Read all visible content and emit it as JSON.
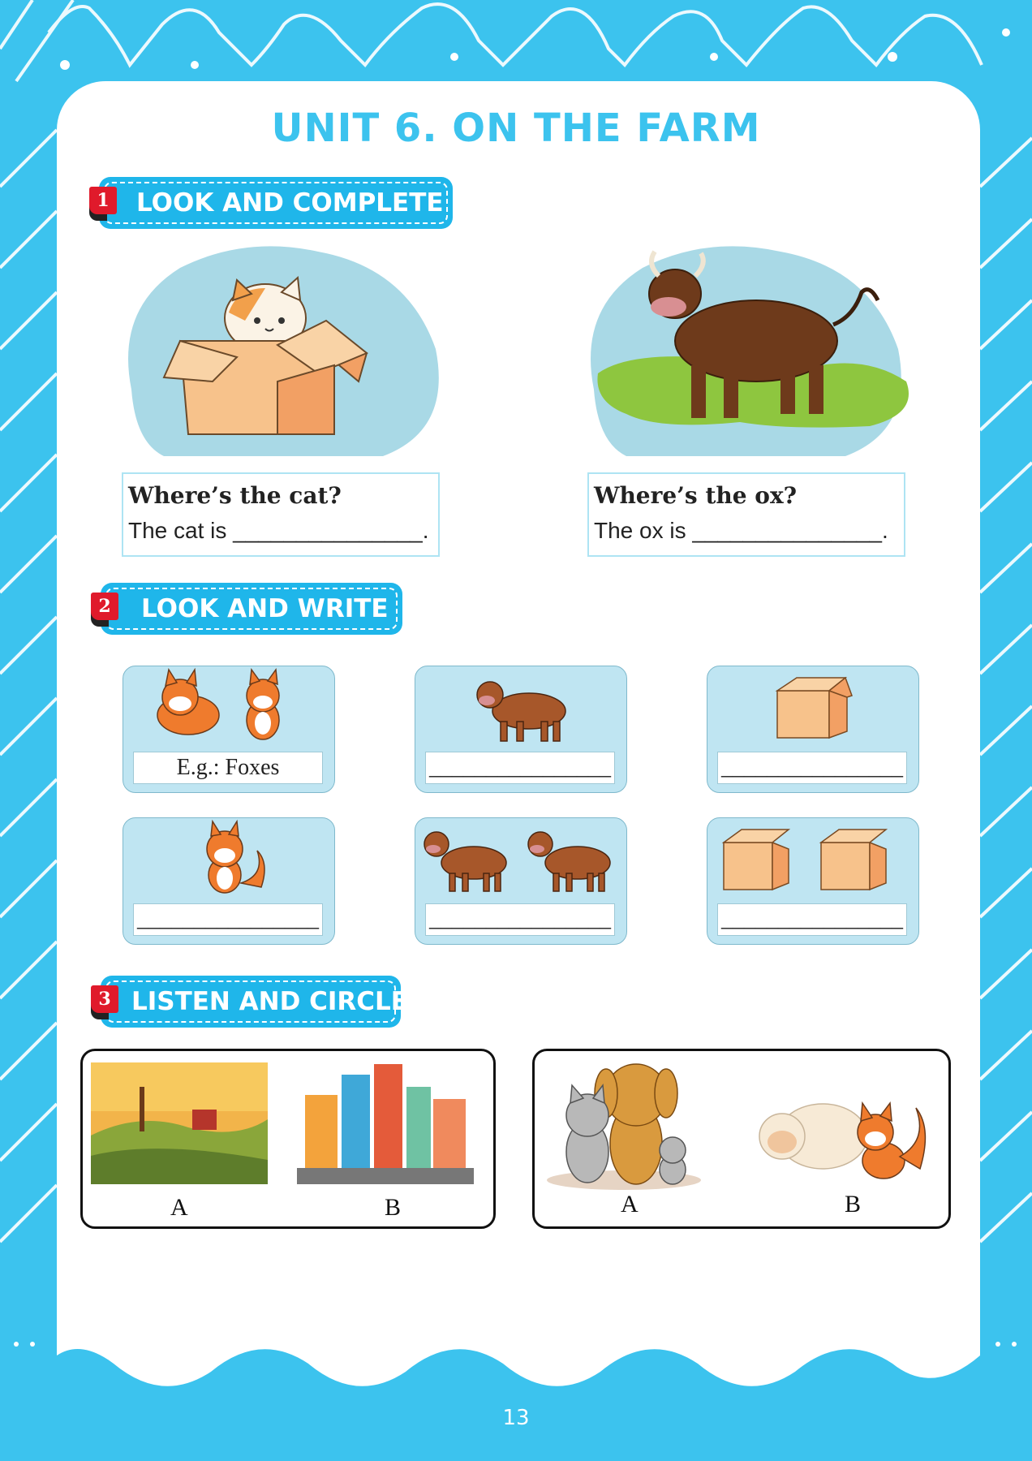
{
  "title": "UNIT 6. ON THE FARM",
  "sections": [
    {
      "number": "1",
      "label": "LOOK AND COMPLETE"
    },
    {
      "number": "2",
      "label": "LOOK AND WRITE"
    },
    {
      "number": "3",
      "label": "LISTEN AND CIRCLE"
    }
  ],
  "look_and_complete": [
    {
      "picture": "cat-in-box",
      "question": "Where’s the cat?",
      "answer": "The cat is _______________."
    },
    {
      "picture": "ox-on-grass",
      "question": "Where’s the ox?",
      "answer": "The ox is _______________."
    }
  ],
  "look_and_write": [
    {
      "picture": "two-foxes",
      "answer": "E.g.: Foxes"
    },
    {
      "picture": "one-ox",
      "answer": "________________"
    },
    {
      "picture": "one-box",
      "answer": "________________"
    },
    {
      "picture": "one-fox",
      "answer": "________________"
    },
    {
      "picture": "two-oxen",
      "answer": "________________"
    },
    {
      "picture": "two-boxes",
      "answer": "________________"
    }
  ],
  "listen_and_circle": [
    {
      "options": [
        {
          "label": "A",
          "picture": "farm-landscape"
        },
        {
          "label": "B",
          "picture": "city-buildings"
        }
      ]
    },
    {
      "options": [
        {
          "label": "A",
          "picture": "cats-and-dog"
        },
        {
          "label": "B",
          "picture": "sheep-and-fox"
        }
      ]
    }
  ],
  "page_number": "13",
  "colors": {
    "background": "#3cc3ee",
    "section_pill": "#1fb6ea",
    "section_number": "#e01a2b",
    "card": "#bfe5f2"
  }
}
